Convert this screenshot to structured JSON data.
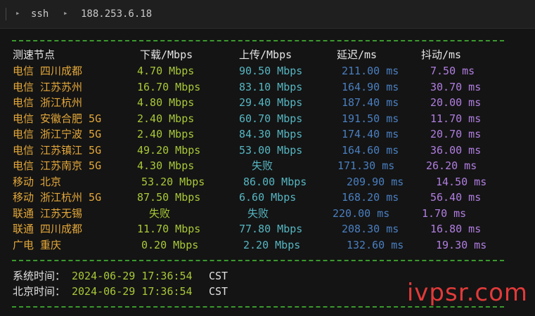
{
  "tab": {
    "arrow1": "▸",
    "label": "ssh",
    "arrow2": "▸",
    "host": "188.253.6.18"
  },
  "headers": {
    "node": "测速节点",
    "down": "下载/Mbps",
    "up": "上传/Mbps",
    "latency": "延迟/ms",
    "jitter": "抖动/ms"
  },
  "rows": [
    {
      "node": "电信 四川成都",
      "down": "4.70 Mbps",
      "up": "90.50 Mbps",
      "latency": "211.00 ms",
      "jitter": "7.50 ms"
    },
    {
      "node": "电信 江苏苏州",
      "down": "16.70 Mbps",
      "up": "83.10 Mbps",
      "latency": "164.90 ms",
      "jitter": "30.70 ms"
    },
    {
      "node": "电信 浙江杭州",
      "down": "4.80 Mbps",
      "up": "29.40 Mbps",
      "latency": "187.40 ms",
      "jitter": "20.00 ms"
    },
    {
      "node": "电信 安徽合肥 5G",
      "down": "2.40 Mbps",
      "up": "60.70 Mbps",
      "latency": "191.50 ms",
      "jitter": "11.70 ms"
    },
    {
      "node": "电信 浙江宁波 5G",
      "down": "2.40 Mbps",
      "up": "84.30 Mbps",
      "latency": "174.40 ms",
      "jitter": "20.70 ms"
    },
    {
      "node": "电信 江苏镇江 5G",
      "down": "49.20 Mbps",
      "up": "53.00 Mbps",
      "latency": "164.60 ms",
      "jitter": "36.00 ms"
    },
    {
      "node": "电信 江苏南京 5G",
      "down": "4.30 Mbps",
      "up": "失败",
      "latency": "171.30 ms",
      "jitter": "26.20 ms"
    },
    {
      "node": "移动 北京",
      "down": "53.20 Mbps",
      "up": "86.00 Mbps",
      "latency": "209.90 ms",
      "jitter": "14.50 ms"
    },
    {
      "node": "移动 浙江杭州 5G",
      "down": "87.50 Mbps",
      "up": "6.60 Mbps",
      "latency": "168.20 ms",
      "jitter": "56.40 ms"
    },
    {
      "node": "联通 江苏无锡",
      "down": "失败",
      "up": "失败",
      "latency": "220.00 ms",
      "jitter": "1.70 ms"
    },
    {
      "node": "联通 四川成都",
      "down": "11.70 Mbps",
      "up": "77.80 Mbps",
      "latency": "208.30 ms",
      "jitter": "16.80 ms"
    },
    {
      "node": "广电 重庆",
      "down": "0.20 Mbps",
      "up": "2.20 Mbps",
      "latency": "132.60 ms",
      "jitter": "19.30 ms"
    }
  ],
  "times": {
    "system_label": "系统时间：",
    "system_value": "2024-06-29 17:36:54",
    "system_zone": "CST",
    "beijing_label": "北京时间：",
    "beijing_value": "2024-06-29 17:36:54",
    "beijing_zone": "CST"
  },
  "watermark": "ivpsr.com",
  "colors": {
    "background": "#141414",
    "rule": "#3a9a2c",
    "node": "#e4a83a",
    "download": "#a8c838",
    "upload": "#56b6c2",
    "latency": "#4a7fc0",
    "jitter": "#b07ee0",
    "watermark": "#e23a3a"
  }
}
